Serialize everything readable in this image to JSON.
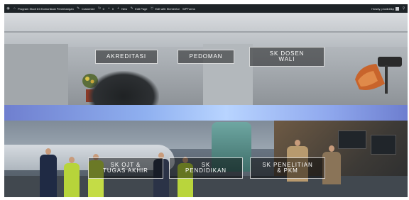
{
  "adminbar": {
    "items": [
      {
        "icon": "wordpress-logo-icon",
        "label": ""
      },
      {
        "icon": "home-icon",
        "label": "Program Studi D3 Komunikasi Penerbangan"
      },
      {
        "icon": "brush-icon",
        "label": "Customize"
      },
      {
        "icon": "updates-icon",
        "label": "0"
      },
      {
        "icon": "comments-icon",
        "label": "0"
      },
      {
        "icon": "plus-icon",
        "label": "New"
      },
      {
        "icon": "pencil-icon",
        "label": "Edit Page"
      },
      {
        "icon": "elementor-icon",
        "label": "Edit with Elementor"
      },
      {
        "icon": "",
        "label": "WPForms"
      }
    ],
    "user_greeting": "Howdy, prodid3kp",
    "search_icon": "search-icon"
  },
  "top_buttons": {
    "akreditasi": "AKREDITASI",
    "pedoman": "PEDOMAN",
    "sk_dosen_wali": "SK DOSEN\nWALI"
  },
  "bottom_buttons": {
    "sk_ojt": "SK OJT &\nTUGAS AKHIR",
    "sk_pendidikan": "SK\nPENDIDIKAN",
    "sk_penelitian": "SK PENELITIAN\n& PKM"
  },
  "colors": {
    "admin_bar": "#1d2327",
    "band_accent": "#8fb0f0",
    "button_border": "#ffffff"
  }
}
